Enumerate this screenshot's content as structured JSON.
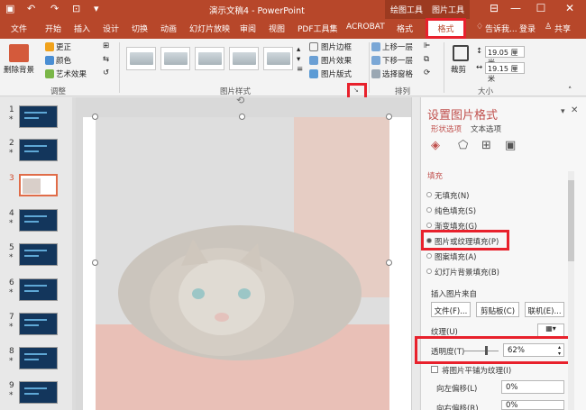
{
  "window": {
    "title": "演示文稿4 - PowerPoint",
    "contextual_drawing": "绘图工具",
    "contextual_picture": "图片工具",
    "minimize": "—",
    "maximize": "☐",
    "close": "✕"
  },
  "tabs": [
    "文件",
    "开始",
    "插入",
    "设计",
    "切换",
    "动画",
    "幻灯片放映",
    "审阅",
    "视图",
    "PDF工具集",
    "ACROBAT",
    "格式",
    "格式"
  ],
  "tell_me": "告诉我...",
  "login": "登录",
  "share": "共享",
  "ribbon": {
    "remove_bg": "删除背景",
    "correct": "更正",
    "color": "颜色",
    "art_effects": "艺术效果",
    "adjust_group": "调整",
    "picture_border": "图片边框",
    "picture_effects": "图片效果",
    "picture_layout": "图片版式",
    "picture_styles_group": "图片样式",
    "bring_forward": "上移一层",
    "send_backward": "下移一层",
    "selection_pane": "选择窗格",
    "arrange_group": "排列",
    "crop": "裁剪",
    "height": "19.05 厘米",
    "width": "19.15 厘米",
    "size_group": "大小"
  },
  "slides": [
    {
      "num": "1"
    },
    {
      "num": "2"
    },
    {
      "num": "3"
    },
    {
      "num": "4"
    },
    {
      "num": "5"
    },
    {
      "num": "6"
    },
    {
      "num": "7"
    },
    {
      "num": "8"
    },
    {
      "num": "9"
    }
  ],
  "star": "*",
  "pane": {
    "title": "设置图片格式",
    "tab_shape": "形状选项",
    "tab_text": "文本选项",
    "section": "填充",
    "fill_options": [
      "无填充(N)",
      "纯色填充(S)",
      "渐变填充(G)",
      "图片或纹理填充(P)",
      "图案填充(A)",
      "幻灯片背景填充(B)"
    ],
    "insert_from": "插入图片来自",
    "btn_file": "文件(F)...",
    "btn_clipboard": "剪贴板(C)",
    "btn_online": "联机(E)...",
    "texture": "纹理(U)",
    "transparency_label": "透明度(T)",
    "transparency_value": "62%",
    "tile_label": "将图片平铺为纹理(I)",
    "offset_left_label": "向左偏移(L)",
    "offset_left_value": "0%",
    "offset_right_label": "向右偏移(R)",
    "offset_right_value": "0%"
  },
  "colors": {
    "accent": "#b7472a",
    "highlight": "#e8212c",
    "pane_title": "#c0504d"
  },
  "transparency_fraction": 0.62
}
